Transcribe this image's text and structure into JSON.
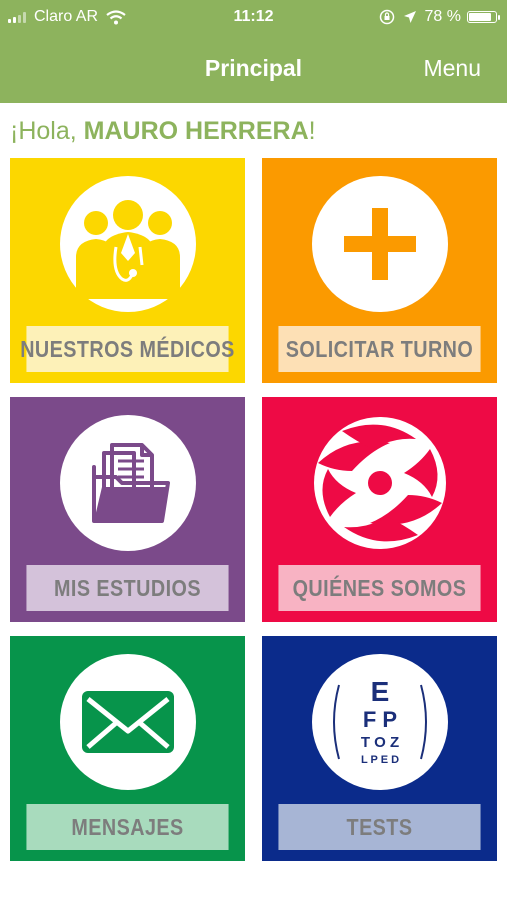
{
  "status_bar": {
    "carrier": "Claro AR",
    "time": "11:12",
    "battery_percent": "78 %",
    "battery_level": 0.78
  },
  "nav": {
    "title": "Principal",
    "menu_label": "Menu"
  },
  "greeting": {
    "prefix": "¡Hola, ",
    "name": "MAURO HERRERA",
    "suffix": "!"
  },
  "tiles": [
    {
      "label": "NUESTROS MÉDICOS",
      "icon": "doctors-icon",
      "color": "#fcd700",
      "label_bg": "#fdf1b8"
    },
    {
      "label": "SOLICITAR TURNO",
      "icon": "plus-icon",
      "color": "#fb9a00",
      "label_bg": "#fde0b5"
    },
    {
      "label": "MIS ESTUDIOS",
      "icon": "folder-icon",
      "color": "#7b4a8a",
      "label_bg": "#d4c2da"
    },
    {
      "label": "QUIÉNES SOMOS",
      "icon": "swirl-logo-icon",
      "color": "#ee0a45",
      "label_bg": "#f8b3c3"
    },
    {
      "label": "MENSAJES",
      "icon": "envelope-icon",
      "color": "#07944b",
      "label_bg": "#a8dbbd"
    },
    {
      "label": "TESTS",
      "icon": "eye-chart-icon",
      "color": "#0b2b8b",
      "label_bg": "#a7b5d5"
    }
  ],
  "eye_chart": {
    "row1": "E",
    "row2": "F P",
    "row3": "T O Z",
    "row4": "L P E D"
  }
}
